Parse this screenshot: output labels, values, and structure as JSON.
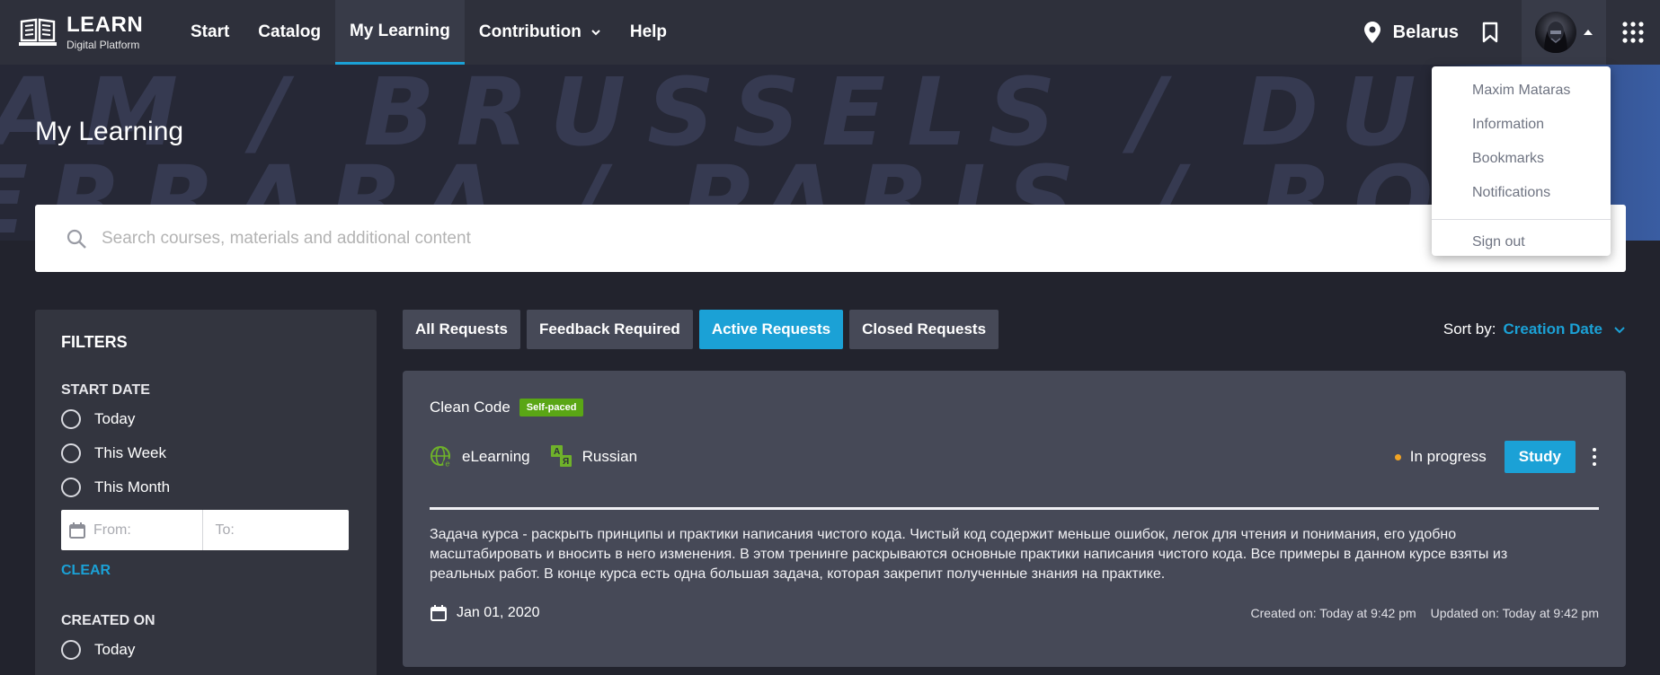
{
  "brand": {
    "title": "LEARN",
    "subtitle": "Digital Platform"
  },
  "nav": {
    "items": [
      {
        "label": "Start"
      },
      {
        "label": "Catalog"
      },
      {
        "label": "My Learning"
      },
      {
        "label": "Contribution"
      },
      {
        "label": "Help"
      }
    ],
    "active": "My Learning"
  },
  "header_right": {
    "location": "Belarus"
  },
  "hero": {
    "title": "My Learning",
    "background_words": [
      "AM / BRUSSELS / DUBLIN / POTSDAM / B",
      "ERRARA / PARIS / ROME / OSLO / FA"
    ]
  },
  "search": {
    "placeholder": "Search courses, materials and additional content",
    "value": ""
  },
  "user_menu": {
    "items": [
      "Maxim Mataras",
      "Information",
      "Bookmarks",
      "Notifications"
    ],
    "sign_out": "Sign out"
  },
  "filters": {
    "title": "FILTERS",
    "start_date": {
      "label": "START DATE",
      "options": [
        "Today",
        "This Week",
        "This Month"
      ],
      "from_placeholder": "From:",
      "to_placeholder": "To:",
      "clear_label": "CLEAR"
    },
    "created_on": {
      "label": "CREATED ON",
      "options": [
        "Today"
      ]
    }
  },
  "tabs": {
    "items": [
      "All Requests",
      "Feedback Required",
      "Active Requests",
      "Closed Requests"
    ],
    "active": "Active Requests"
  },
  "sort": {
    "label": "Sort by:",
    "value": "Creation Date"
  },
  "course": {
    "title": "Clean Code",
    "badge": "Self-paced",
    "format": "eLearning",
    "language": "Russian",
    "status": "In progress",
    "action": "Study",
    "description": "Задача курса - раскрыть принципы и практики написания чистого кода. Чистый код содержит меньше ошибок, легок для чтения и понимания, его удобно масштабировать и вносить в него изменения. В этом тренинге раскрываются основные практики написания чистого кода. Все примеры в данном курсе взяты из реальных работ. В конце курса есть одна большая задача, которая закрепит полученные знания на практике.",
    "date": "Jan 01, 2020",
    "created": "Created on: Today at 9:42 pm",
    "updated": "Updated on: Today at 9:42 pm"
  },
  "colors": {
    "accent": "#1ba1d6",
    "badge": "#5aa615",
    "status_dot": "#f0a324",
    "topbar": "#2e303b",
    "card": "#464957"
  },
  "icons": [
    "book-logo-icon",
    "chevron-down-icon",
    "location-pin-icon",
    "bookmark-icon",
    "avatar",
    "caret-up-icon",
    "apps-grid-icon",
    "search-icon",
    "calendar-icon",
    "globe-icon",
    "translate-icon",
    "kebab-menu-icon"
  ]
}
